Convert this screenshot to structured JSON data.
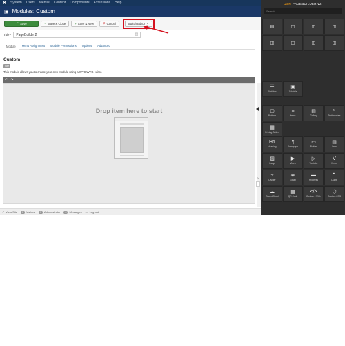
{
  "topnav": {
    "items": [
      "System",
      "Users",
      "Menus",
      "Content",
      "Components",
      "Extensions",
      "Help"
    ]
  },
  "titlebar": {
    "title": "Modules: Custom"
  },
  "toolbar": {
    "save": "Save",
    "save_close": "Save & Close",
    "save_new": "Save & New",
    "cancel": "Cancel",
    "switch_editor": "Switch Editor"
  },
  "form": {
    "title_label": "Title *",
    "title_value": "PageBuilder2"
  },
  "tabs": [
    "Module",
    "Menu Assignment",
    "Module Permissions",
    "Options",
    "Advanced"
  ],
  "module": {
    "name": "Custom",
    "badge": "Site",
    "description": "This module allows you to create your own Module using a WYSIWYG editor."
  },
  "dropzone": {
    "text": "Drop item here to start"
  },
  "statusbar": {
    "view_site": "View Site",
    "visitors_count": "0",
    "visitors": "Visitors",
    "admin_count": "1",
    "admin": "Administrator",
    "messages_count": "0",
    "messages": "Messages",
    "logout": "Log out"
  },
  "pagebuilder": {
    "brand": "JSN",
    "title": "PAGEBUILDER v2",
    "search_placeholder": "Search...",
    "widgets_row1": [
      {
        "label": "JArticles",
        "icon": "list-icon",
        "glyph": "☰"
      },
      {
        "label": "JModule",
        "icon": "cube-icon",
        "glyph": "▣"
      }
    ],
    "widgets_row2": [
      {
        "label": "Buttons",
        "icon": "cursor-icon",
        "glyph": "▢"
      },
      {
        "label": "Items",
        "icon": "list-icon",
        "glyph": "≡"
      },
      {
        "label": "Gallery",
        "icon": "gallery-icon",
        "glyph": "▤"
      },
      {
        "label": "Testimonials",
        "icon": "quote-icon",
        "glyph": "❝"
      },
      {
        "label": "Pricing Tables",
        "icon": "pricing-icon",
        "glyph": "▦"
      }
    ],
    "widgets_row3": [
      {
        "label": "Heading",
        "icon": "heading-icon",
        "glyph": "H1"
      },
      {
        "label": "Paragraph",
        "icon": "paragraph-icon",
        "glyph": "¶"
      },
      {
        "label": "Button",
        "icon": "button-icon",
        "glyph": "▭"
      },
      {
        "label": "Item",
        "icon": "item-icon",
        "glyph": "▤"
      },
      {
        "label": "Image",
        "icon": "image-icon",
        "glyph": "▨"
      },
      {
        "label": "Video",
        "icon": "video-icon",
        "glyph": "▶"
      },
      {
        "label": "Youtube",
        "icon": "youtube-icon",
        "glyph": "▷"
      },
      {
        "label": "Vimeo",
        "icon": "vimeo-icon",
        "glyph": "V"
      },
      {
        "label": "Divider",
        "icon": "divider-icon",
        "glyph": "÷"
      },
      {
        "label": "GMap",
        "icon": "map-icon",
        "glyph": "◈"
      },
      {
        "label": "Progress",
        "icon": "progress-icon",
        "glyph": "▬"
      },
      {
        "label": "Quote",
        "icon": "quote-icon",
        "glyph": "❞"
      },
      {
        "label": "SoundCloud",
        "icon": "soundcloud-icon",
        "glyph": "☁"
      },
      {
        "label": "QR Code",
        "icon": "qrcode-icon",
        "glyph": "▦"
      },
      {
        "label": "Custom HTML",
        "icon": "html-icon",
        "glyph": "</>"
      },
      {
        "label": "Custom CSS",
        "icon": "css-icon",
        "glyph": "⬡"
      }
    ]
  },
  "colors": {
    "nav_bg": "#17365c",
    "save_green": "#3c8b3c",
    "highlight_red": "#d4121f",
    "panel_bg": "#2e2e2e",
    "brand_orange": "#f39c12"
  }
}
